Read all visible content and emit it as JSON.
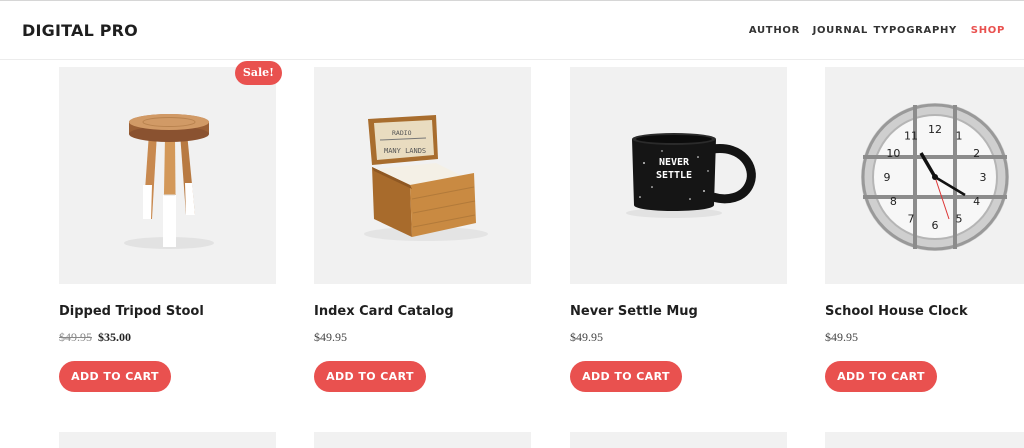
{
  "site": {
    "logo": "DIGITAL PRO"
  },
  "nav": {
    "items": [
      {
        "label": "AUTHOR"
      },
      {
        "label": "JOURNAL"
      },
      {
        "label": "TYPOGRAPHY"
      },
      {
        "label": "SHOP",
        "active": true
      }
    ]
  },
  "products": [
    {
      "name": "Dipped Tripod Stool",
      "badge": "Sale!",
      "price_old": "$49.95",
      "price": "$35.00",
      "button": "ADD TO CART",
      "image_icon": "stool-icon"
    },
    {
      "name": "Index Card Catalog",
      "price": "$49.95",
      "button": "ADD TO CART",
      "image_icon": "card-catalog-icon"
    },
    {
      "name": "Never Settle Mug",
      "price": "$49.95",
      "button": "ADD TO CART",
      "image_icon": "mug-icon",
      "mug_text": [
        "NEVER",
        "SETTLE"
      ]
    },
    {
      "name": "School House Clock",
      "price": "$49.95",
      "button": "ADD TO CART",
      "image_icon": "clock-icon",
      "clock_numerals": [
        "12",
        "1",
        "2",
        "3",
        "4",
        "5",
        "6",
        "7",
        "8",
        "9",
        "10",
        "11"
      ]
    }
  ],
  "catalog_label_text": [
    "RADIO",
    "MANY LANDS"
  ],
  "colors": {
    "accent": "#e9514f",
    "thumb_bg": "#f1f1f1",
    "text": "#1f1f1f"
  }
}
